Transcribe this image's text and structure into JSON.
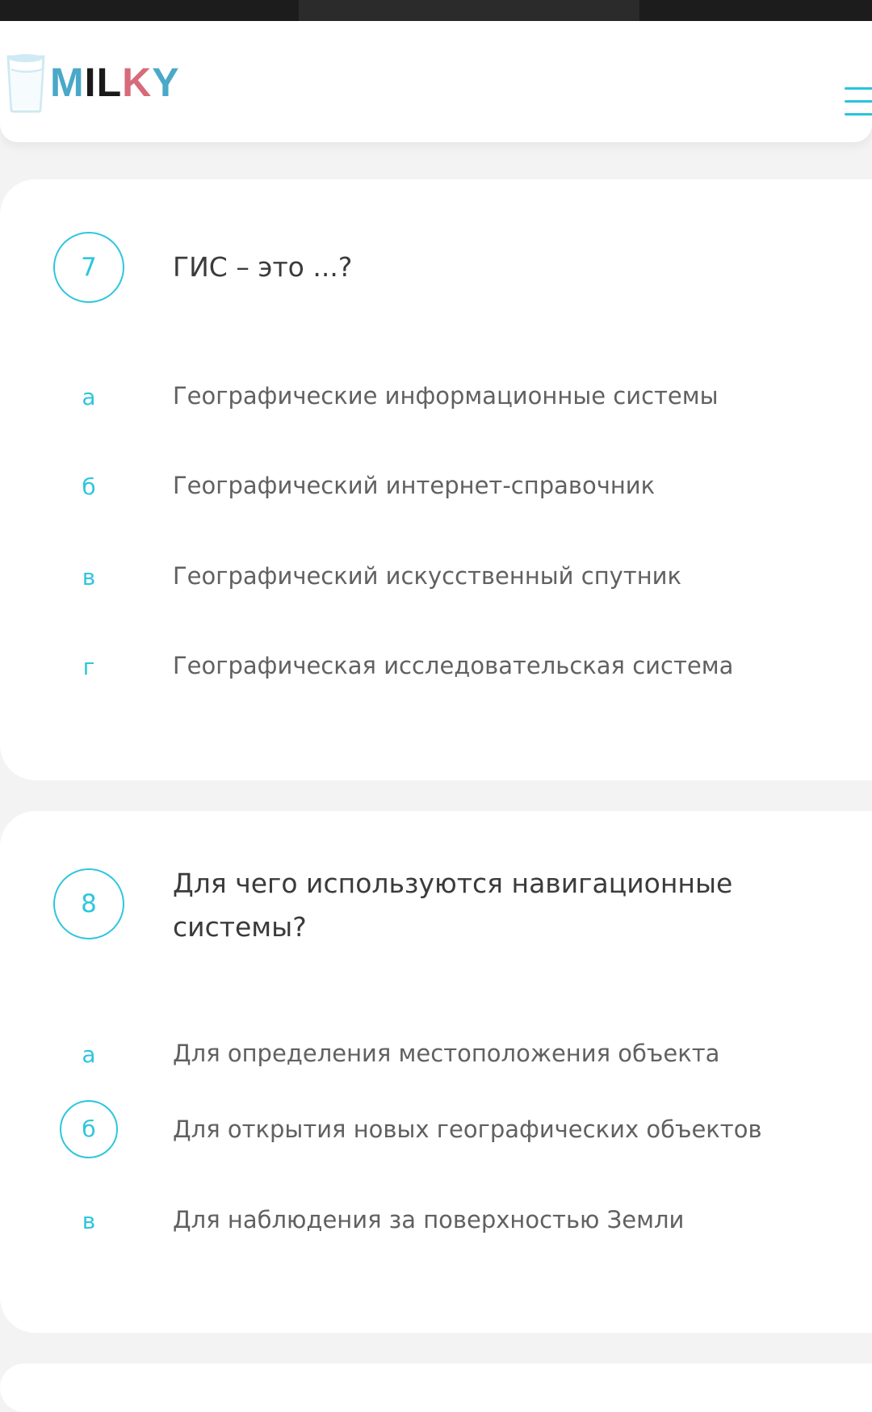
{
  "logo": {
    "text": "MILKY",
    "letters": [
      "M",
      "I",
      "L",
      "K",
      "Y"
    ]
  },
  "header": {
    "menu_icon": "hamburger-menu-icon"
  },
  "questions": [
    {
      "number": "7",
      "text": "ГИС – это ...?",
      "options": [
        {
          "letter": "а",
          "text": "Географические информационные системы",
          "selected": false
        },
        {
          "letter": "б",
          "text": "Географический интернет-справочник",
          "selected": false
        },
        {
          "letter": "в",
          "text": "Географический искусственный спутник",
          "selected": false
        },
        {
          "letter": "г",
          "text": "Географическая исследовательская система",
          "selected": false
        }
      ]
    },
    {
      "number": "8",
      "text": "Для чего используются навигационные системы?",
      "options": [
        {
          "letter": "а",
          "text": "Для определения местоположения объекта",
          "selected": false
        },
        {
          "letter": "б",
          "text": "Для открытия новых географических объектов",
          "selected": true
        },
        {
          "letter": "в",
          "text": "Для наблюдения за поверхностью Земли",
          "selected": false
        }
      ]
    }
  ],
  "colors": {
    "accent": "#2ec6dd",
    "card_bg": "#ffffff",
    "page_bg": "#f3f3f3",
    "question_text": "#3b3b3b",
    "option_text": "#616161"
  }
}
